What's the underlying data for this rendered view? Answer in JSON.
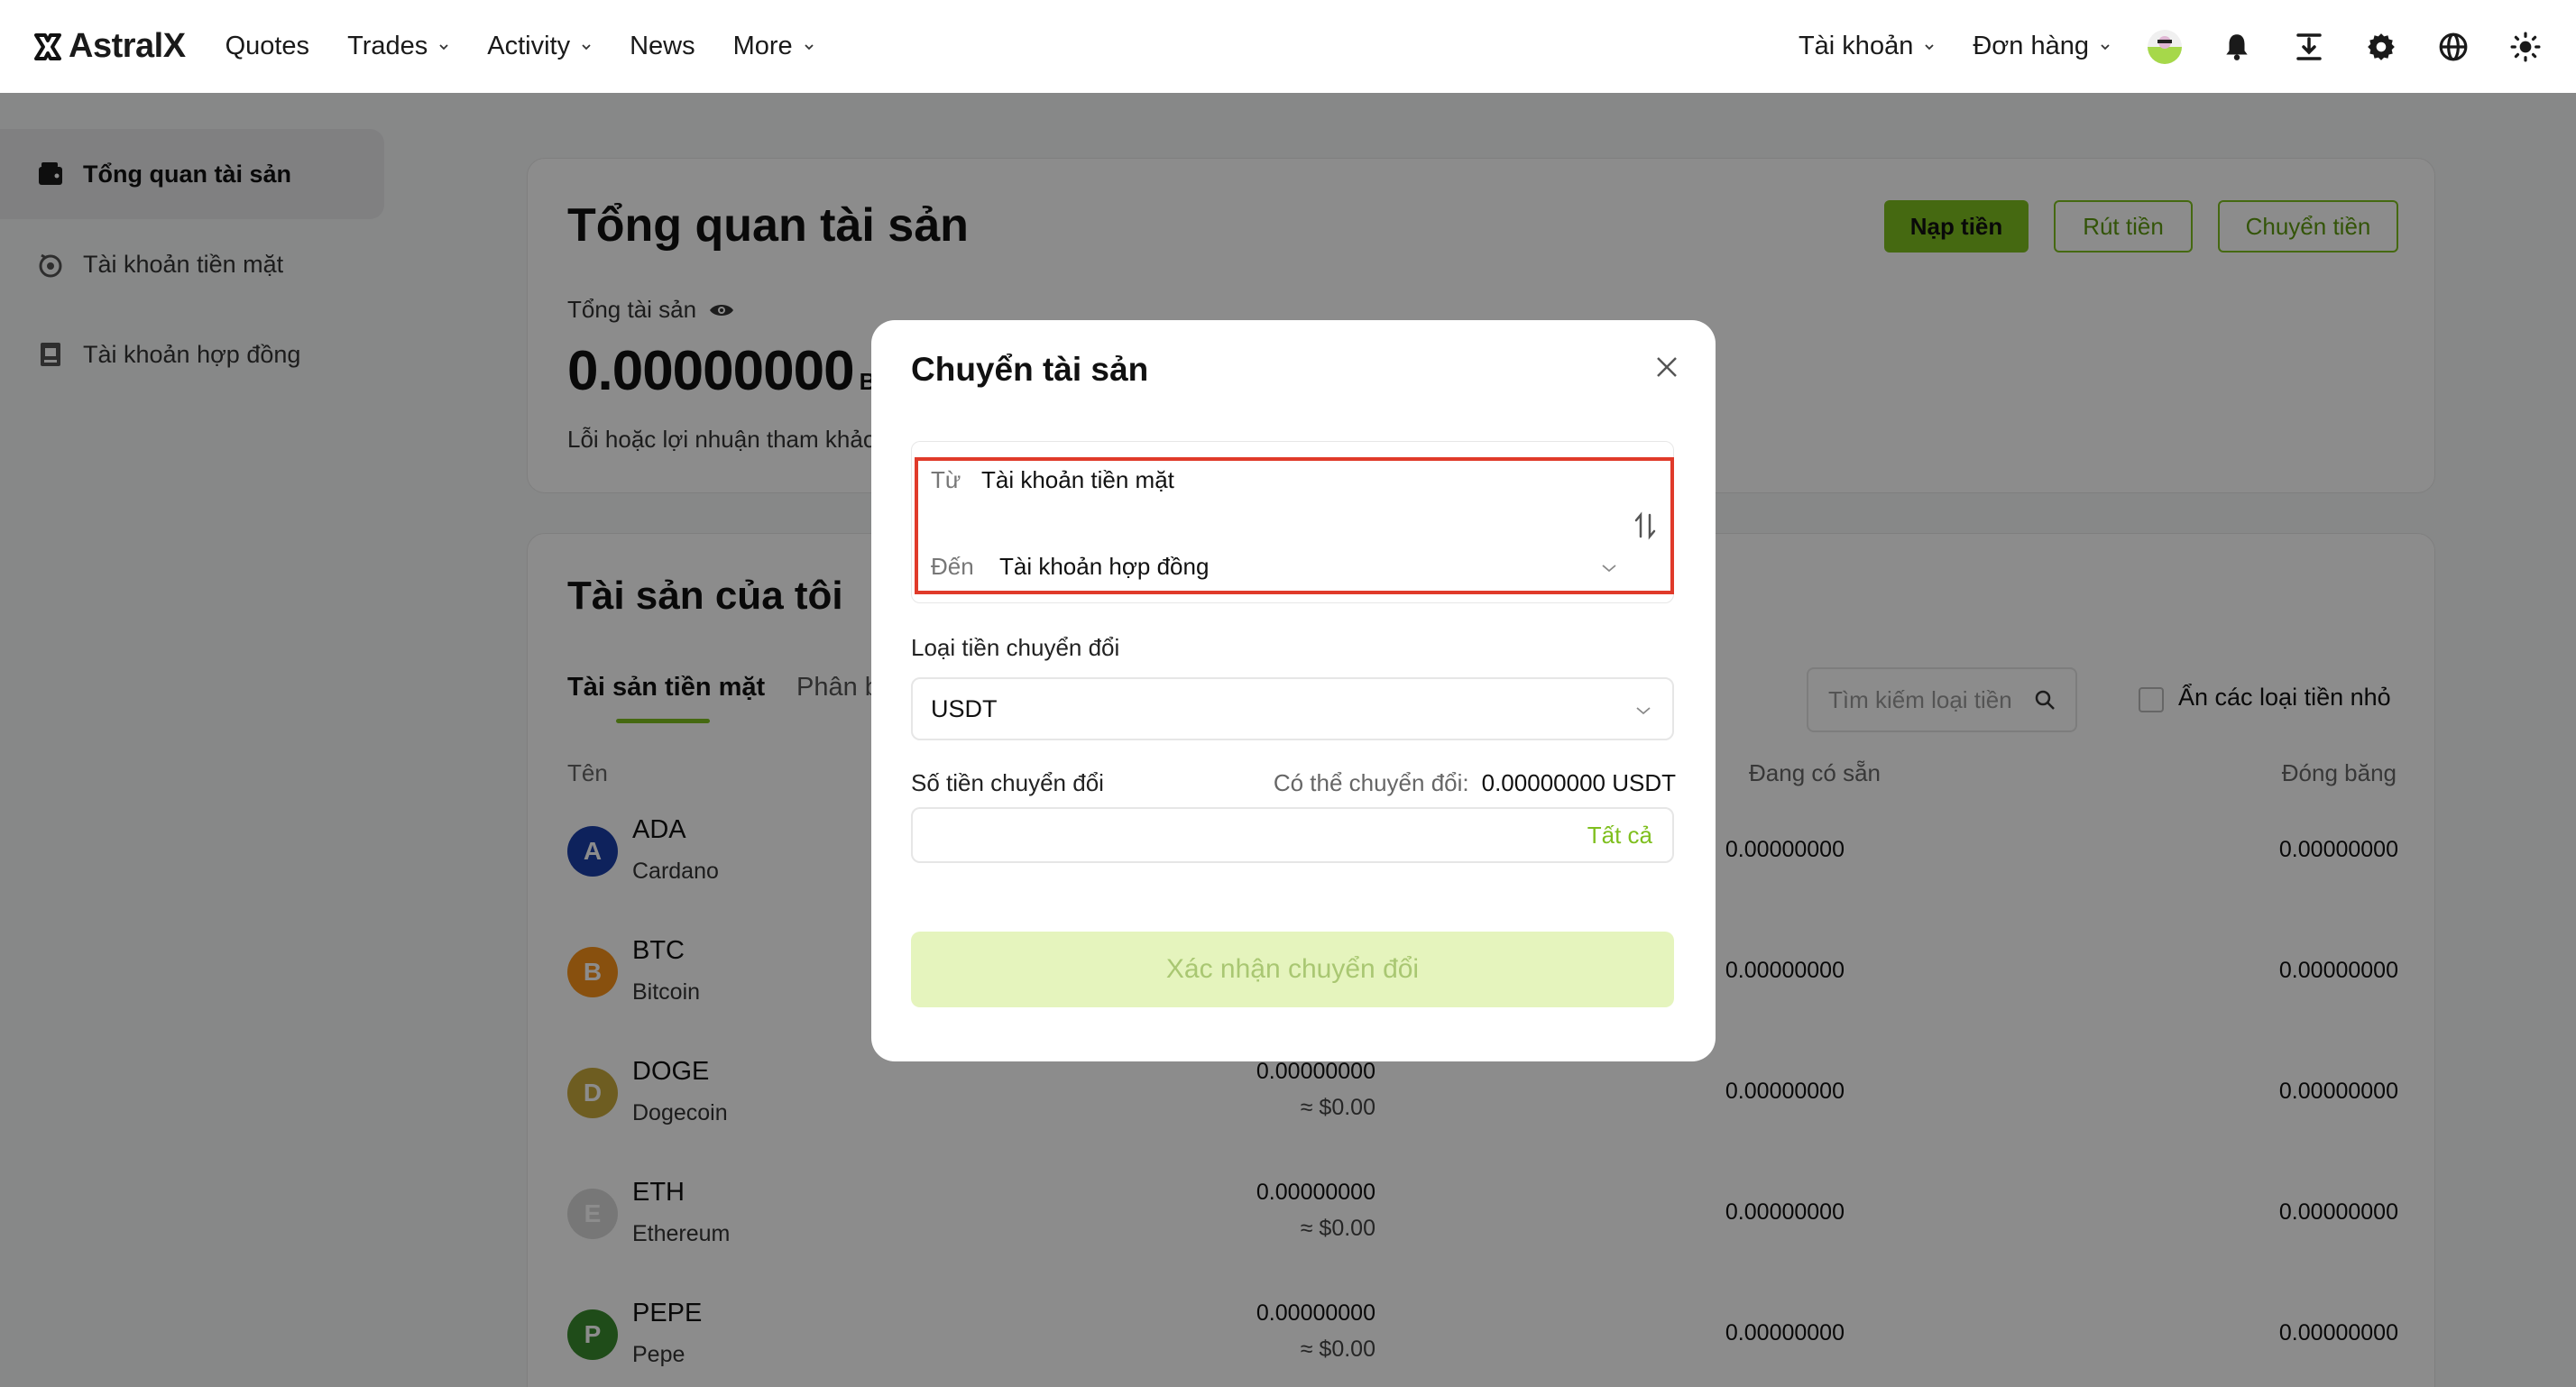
{
  "header": {
    "logo": "AstralX",
    "nav": [
      {
        "label": "Quotes",
        "dropdown": false
      },
      {
        "label": "Trades",
        "dropdown": true
      },
      {
        "label": "Activity",
        "dropdown": true
      },
      {
        "label": "News",
        "dropdown": false
      },
      {
        "label": "More",
        "dropdown": true
      }
    ],
    "account_label": "Tài khoản",
    "orders_label": "Đơn hàng",
    "icons": [
      "avatar",
      "bell-icon",
      "download-icon",
      "gear-icon",
      "globe-icon",
      "theme-sun-icon"
    ]
  },
  "sidebar": {
    "items": [
      {
        "label": "Tổng quan tài sản",
        "icon": "wallet-icon",
        "active": true
      },
      {
        "label": "Tài khoản tiền mặt",
        "icon": "cash-icon",
        "active": false
      },
      {
        "label": "Tài khoản hợp đồng",
        "icon": "contract-icon",
        "active": false
      }
    ]
  },
  "overview": {
    "title": "Tổng quan tài sản",
    "deposit": "Nạp tiền",
    "withdraw": "Rút tiền",
    "transfer": "Chuyển tiền",
    "total_label": "Tổng tài sản",
    "total_value": "0.00000000",
    "total_unit": "B",
    "pnl_label": "Lỗi hoặc lợi nhuận tham khảo"
  },
  "assets": {
    "title": "Tài sản của tôi",
    "tab_active": "Tài sản tiền mặt",
    "tab_other": "Phân b",
    "search_placeholder": "Tìm kiếm loại tiền",
    "hide_small": "Ẩn các loại tiền nhỏ",
    "col_name": "Tên",
    "col_available": "Đang có sẵn",
    "col_frozen": "Đóng băng",
    "rows": [
      {
        "symbol": "ADA",
        "name": "Cardano",
        "total": "",
        "usd": "",
        "available": "0.00000000",
        "frozen": "0.00000000",
        "color": "#1b3fa8"
      },
      {
        "symbol": "BTC",
        "name": "Bitcoin",
        "total": "",
        "usd": "",
        "available": "0.00000000",
        "frozen": "0.00000000",
        "color": "#f7931a"
      },
      {
        "symbol": "DOGE",
        "name": "Dogecoin",
        "total": "0.00000000",
        "usd": "≈ $0.00",
        "available": "0.00000000",
        "frozen": "0.00000000",
        "color": "#c9a93d"
      },
      {
        "symbol": "ETH",
        "name": "Ethereum",
        "total": "0.00000000",
        "usd": "≈ $0.00",
        "available": "0.00000000",
        "frozen": "0.00000000",
        "color": "#d9d9d9"
      },
      {
        "symbol": "PEPE",
        "name": "Pepe",
        "total": "0.00000000",
        "usd": "≈ $0.00",
        "available": "0.00000000",
        "frozen": "0.00000000",
        "color": "#3a8a2e"
      }
    ]
  },
  "modal": {
    "title": "Chuyển tài sản",
    "from_label": "Từ",
    "from_value": "Tài khoản tiền mặt",
    "to_label": "Đến",
    "to_value": "Tài khoản hợp đồng",
    "currency_label": "Loại tiền chuyển đổi",
    "currency_value": "USDT",
    "amount_label": "Số tiền chuyển đổi",
    "available_label": "Có thể chuyển đổi:",
    "available_value": "0.00000000 USDT",
    "all_link": "Tất cả",
    "confirm": "Xác nhận chuyển đổi"
  },
  "colors": {
    "brand": "#7fbf1f",
    "highlight": "#e03a2a"
  }
}
